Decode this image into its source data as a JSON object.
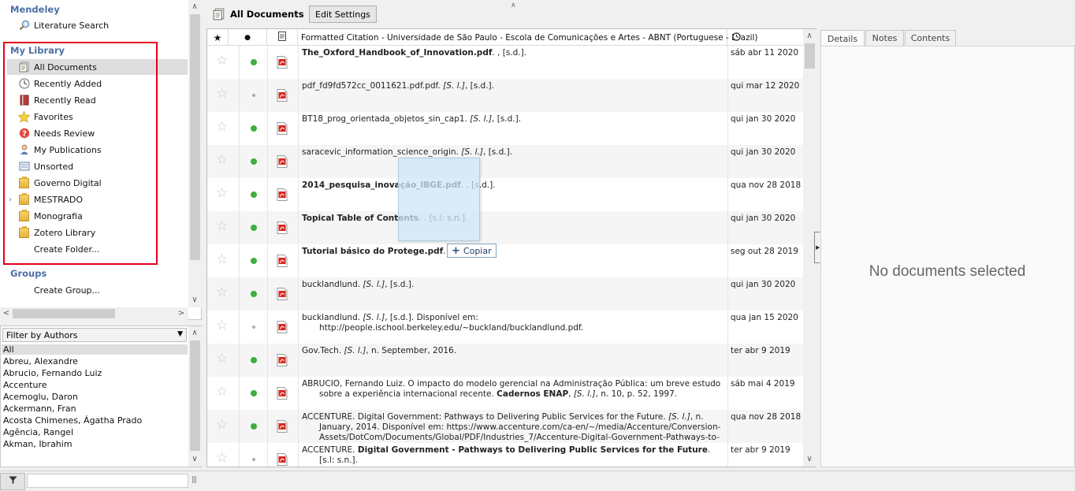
{
  "sidebar": {
    "mendeley_title": "Mendeley",
    "literature_search": "Literature Search",
    "my_library_title": "My Library",
    "items": [
      {
        "label": "All Documents",
        "icon": "all-documents-icon"
      },
      {
        "label": "Recently Added",
        "icon": "clock-icon"
      },
      {
        "label": "Recently Read",
        "icon": "book-icon"
      },
      {
        "label": "Favorites",
        "icon": "star-icon"
      },
      {
        "label": "Needs Review",
        "icon": "question-icon"
      },
      {
        "label": "My Publications",
        "icon": "person-icon"
      },
      {
        "label": "Unsorted",
        "icon": "tray-icon"
      },
      {
        "label": "Governo Digital",
        "icon": "folder-icon"
      },
      {
        "label": "MESTRADO",
        "icon": "folder-icon"
      },
      {
        "label": "Monografia",
        "icon": "folder-icon"
      },
      {
        "label": "Zotero Library",
        "icon": "folder-icon"
      }
    ],
    "create_folder": "Create Folder...",
    "groups_title": "Groups",
    "create_group": "Create Group..."
  },
  "filter": {
    "header": "Filter by Authors",
    "authors": [
      "All",
      "Abreu, Alexandre",
      "Abrucio, Fernando Luiz",
      "Accenture",
      "Acemoglu, Daron",
      "Ackermann, Fran",
      "Acosta Chimenes, Ágatha Prado",
      "Agência, Rangel",
      "Akman, Ibrahim"
    ]
  },
  "toolbar": {
    "title": "All Documents",
    "edit_settings": "Edit Settings"
  },
  "columns": {
    "citation": "Formatted Citation - Universidade de São Paulo - Escola de Comunicações e Artes - ABNT (Portuguese - Brazil)"
  },
  "documents": [
    {
      "cite_html": "<b>The_Oxford_Handbook_of_Innovation.pdf</b>. , [s.d.].",
      "date": "sáb abr 11 2020",
      "read": false
    },
    {
      "cite_html": "pdf_fd9fd572cc_0011621.pdf.pdf. <i>[S. l.]</i>, [s.d.].",
      "date": "qui mar 12 2020",
      "read": true
    },
    {
      "cite_html": "BT18_prog_orientada_objetos_sin_cap1. <i>[S. l.]</i>, [s.d.].",
      "date": "qui jan 30 2020",
      "read": false
    },
    {
      "cite_html": "saracevic_information_science_origin. <i>[S. l.]</i>, [s.d.].",
      "date": "qui jan 30 2020",
      "read": false
    },
    {
      "cite_html": "<b>2014_pesquisa_inovação_IBGE.pdf</b>. , [s.d.].",
      "date": "qua nov 28 2018",
      "read": false
    },
    {
      "cite_html": "<b>Topical Table of Contents</b>. . [s.l: s.n.].",
      "date": "qui jan 30 2020",
      "read": false
    },
    {
      "cite_html": "<b>Tutorial básico do Protege.pdf</b>. , [s.d.].",
      "date": "seg out 28 2019",
      "read": false
    },
    {
      "cite_html": "bucklandlund. <i>[S. l.]</i>, [s.d.].",
      "date": "qui jan 30 2020",
      "read": false
    },
    {
      "cite_html": "bucklandlund. <i>[S. l.]</i>, [s.d.]. Disponível em: http://people.ischool.berkeley.edu/~buckland/bucklandlund.pdf.",
      "date": "qua jan 15 2020",
      "read": true
    },
    {
      "cite_html": "Gov.Tech. <i>[S. l.]</i>, n. September, 2016.",
      "date": "ter abr 9 2019",
      "read": false
    },
    {
      "cite_html": "ABRUCIO, Fernando Luiz. O impacto do modelo gerencial na Administração Pública: um breve estudo sobre a experiência internacional recente. <b>Cadernos ENAP</b>, <i>[S. l.]</i>, n. 10, p. 52, 1997.",
      "date": "sáb mai 4 2019",
      "read": false
    },
    {
      "cite_html": "ACCENTURE. Digital Government: Pathways to Delivering Public Services for the Future. <i>[S. l.]</i>, n. January, 2014. Disponível em: https://www.accenture.com/ca-en/~/media/Accenture/Conversion-Assets/DotCom/Documents/Global/PDF/Industries_7/Accenture-Digital-Government-Pathways-to-Delivering-Public-Servi...",
      "date": "qua nov 28 2018",
      "read": false
    },
    {
      "cite_html": "ACCENTURE. <b>Digital Government - Pathways to Delivering Public Services for the Future</b>. [s.l: s.n.].",
      "date": "ter abr 9 2019",
      "read": true
    }
  ],
  "drag": {
    "copy_label": "Copiar"
  },
  "details": {
    "tabs": [
      "Details",
      "Notes",
      "Contents"
    ],
    "empty_message": "No documents selected"
  },
  "colors": {
    "accent_title": "#4c6fa5",
    "highlight_box": "#e3001b",
    "unread_dot": "#3fae3f"
  }
}
